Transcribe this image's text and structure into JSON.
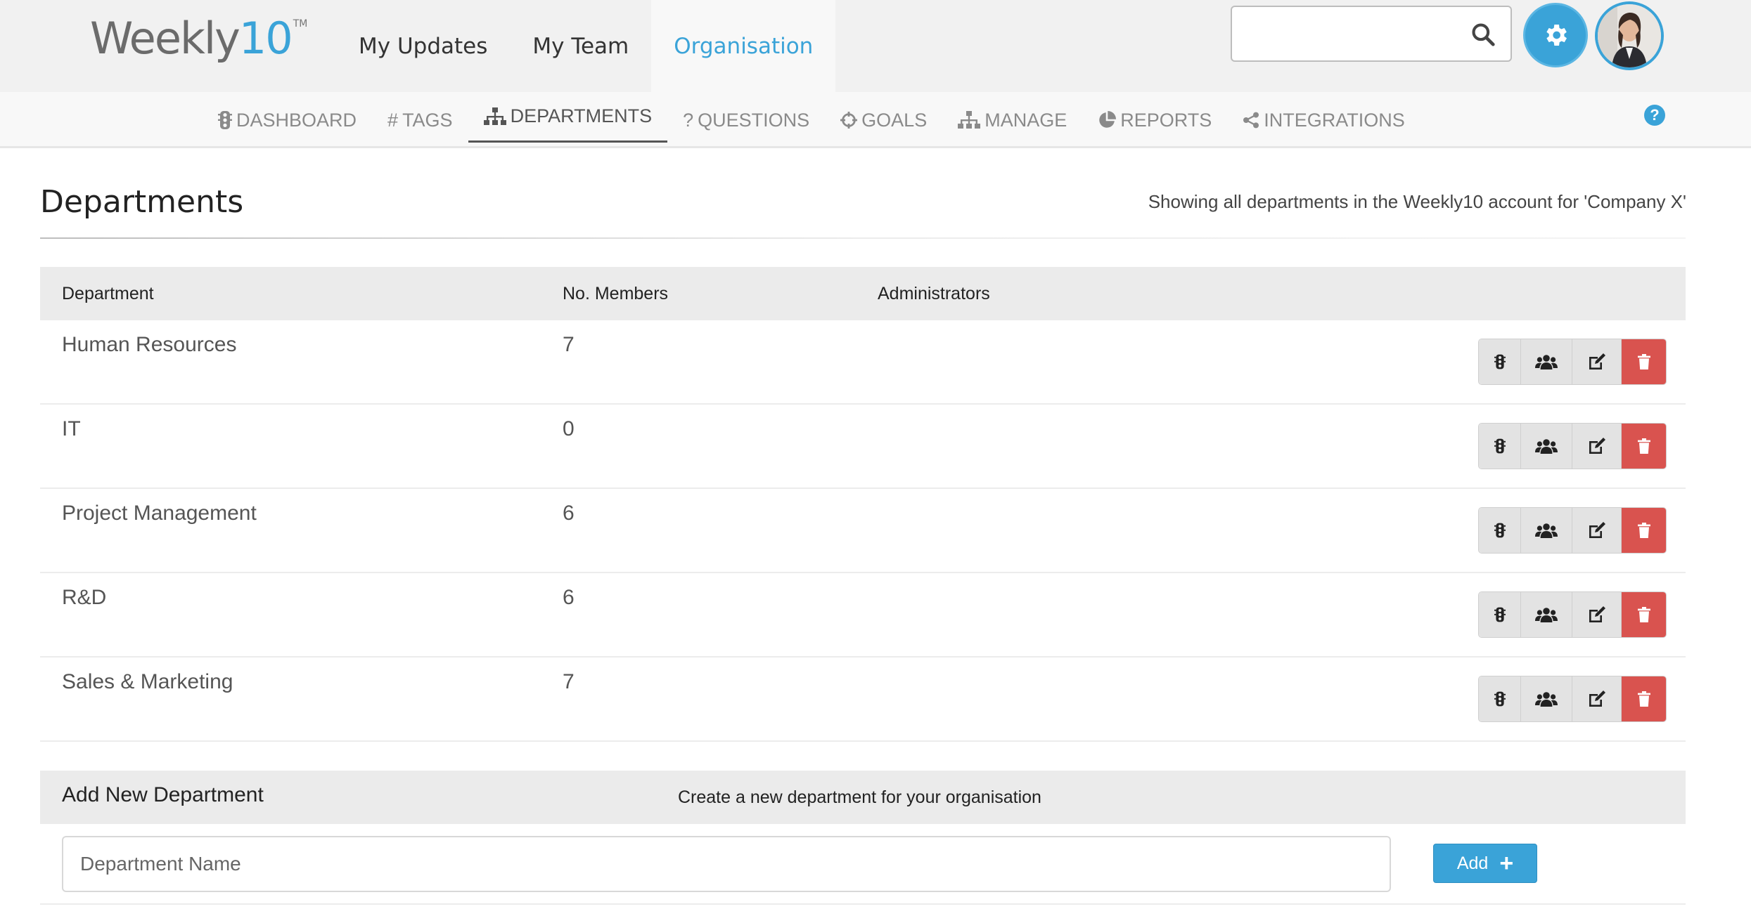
{
  "header": {
    "logo": {
      "main": "Weekly",
      "accent": "10",
      "mark": "TM"
    },
    "nav": [
      {
        "label": "My Updates",
        "active": false
      },
      {
        "label": "My Team",
        "active": false
      },
      {
        "label": "Organisation",
        "active": true
      }
    ],
    "search": {
      "value": "",
      "placeholder": "",
      "icon": "search-icon"
    },
    "settings_icon": "gear-icon"
  },
  "subnav": {
    "tabs": [
      {
        "label": "DASHBOARD",
        "icon": "traffic-light-icon"
      },
      {
        "label": "TAGS",
        "icon": "hashtag-icon"
      },
      {
        "label": "DEPARTMENTS",
        "icon": "sitemap-icon",
        "active": true
      },
      {
        "label": "QUESTIONS",
        "icon": "question-icon"
      },
      {
        "label": "GOALS",
        "icon": "crosshairs-icon"
      },
      {
        "label": "MANAGE",
        "icon": "sitemap-icon"
      },
      {
        "label": "REPORTS",
        "icon": "pie-chart-icon"
      },
      {
        "label": "INTEGRATIONS",
        "icon": "share-icon"
      }
    ],
    "help": "?"
  },
  "page": {
    "title": "Departments",
    "subtitle": "Showing all departments in the Weekly10 account for 'Company X'"
  },
  "table": {
    "headers": [
      "Department",
      "No. Members",
      "Administrators"
    ],
    "rows": [
      {
        "department": "Human Resources",
        "members": "7",
        "administrators": ""
      },
      {
        "department": "IT",
        "members": "0",
        "administrators": ""
      },
      {
        "department": "Project Management",
        "members": "6",
        "administrators": ""
      },
      {
        "department": "R&D",
        "members": "6",
        "administrators": ""
      },
      {
        "department": "Sales & Marketing",
        "members": "7",
        "administrators": ""
      }
    ],
    "row_actions": [
      "traffic-light-icon",
      "users-icon",
      "edit-icon",
      "trash-icon"
    ]
  },
  "add_department": {
    "title": "Add New Department",
    "subtitle": "Create a new department for your organisation",
    "input_placeholder": "Department Name",
    "input_value": "",
    "button_label": "Add",
    "button_icon": "+"
  },
  "colors": {
    "accent": "#3aa3d8",
    "danger": "#d9534f",
    "header_bg": "#f1f1f1",
    "table_header_bg": "#ebebeb"
  }
}
